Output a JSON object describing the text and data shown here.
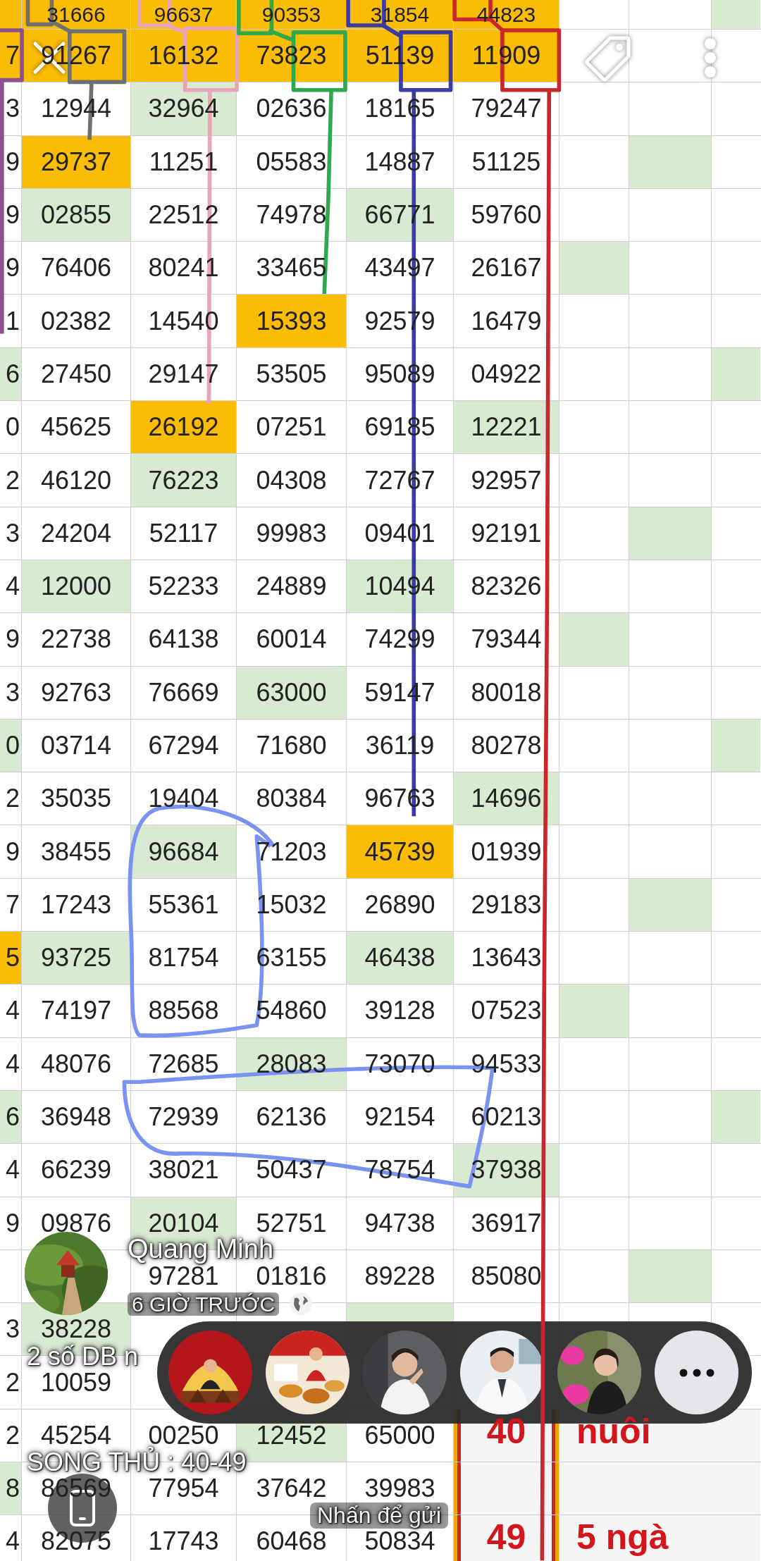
{
  "sheet": {
    "rows": [
      {
        "kind": "plain",
        "cells": [
          {
            "color": "#fbbc04"
          },
          {
            "text": "31666",
            "color": "#fbbc04"
          },
          {
            "text": "96637",
            "color": "#fbbc04"
          },
          {
            "text": "90353",
            "color": "#fbbc04"
          },
          {
            "text": "31854",
            "color": "#fbbc04"
          },
          {
            "text": "44823",
            "color": "#fbbc04"
          },
          {},
          {},
          {
            "color": "#d9ead3"
          }
        ]
      },
      {
        "kind": "plain",
        "cells": [
          {
            "text": "7",
            "color": "#fbbc04"
          },
          {
            "text": "91267",
            "color": "#fbbc04"
          },
          {
            "text": "16132",
            "color": "#fbbc04"
          },
          {
            "text": "73823",
            "color": "#fbbc04"
          },
          {
            "text": "51139",
            "color": "#fbbc04"
          },
          {
            "text": "11909",
            "color": "#fbbc04"
          },
          {},
          {},
          {}
        ]
      },
      {
        "kind": "plain",
        "cells": [
          {
            "text": "3"
          },
          {
            "text": "12944"
          },
          {
            "text": "32964",
            "color": "#d9ead3"
          },
          {
            "text": "02636"
          },
          {
            "text": "18165"
          },
          {
            "text": "79247"
          },
          {},
          {},
          {}
        ]
      },
      {
        "kind": "plain",
        "cells": [
          {
            "text": "9"
          },
          {
            "text": "29737",
            "color": "#fbbc04"
          },
          {
            "text": "11251"
          },
          {
            "text": "05583"
          },
          {
            "text": "14887"
          },
          {
            "text": "51125"
          },
          {},
          {
            "color": "#d9ead3"
          },
          {}
        ]
      },
      {
        "kind": "plain",
        "cells": [
          {
            "text": "9"
          },
          {
            "text": "02855",
            "color": "#d9ead3"
          },
          {
            "text": "22512"
          },
          {
            "text": "74978"
          },
          {
            "text": "66771",
            "color": "#d9ead3"
          },
          {
            "text": "59760"
          },
          {},
          {},
          {}
        ]
      },
      {
        "kind": "plain",
        "cells": [
          {
            "text": "9"
          },
          {
            "text": "76406"
          },
          {
            "text": "80241"
          },
          {
            "text": "33465"
          },
          {
            "text": "43497"
          },
          {
            "text": "26167"
          },
          {
            "color": "#d9ead3"
          },
          {},
          {}
        ]
      },
      {
        "kind": "plain",
        "cells": [
          {
            "text": "1"
          },
          {
            "text": "02382"
          },
          {
            "text": "14540"
          },
          {
            "text": "15393",
            "color": "#fbbc04"
          },
          {
            "text": "92579"
          },
          {
            "text": "16479"
          },
          {},
          {},
          {}
        ]
      },
      {
        "kind": "plain",
        "cells": [
          {
            "text": "6",
            "color": "#d9ead3"
          },
          {
            "text": "27450"
          },
          {
            "text": "29147"
          },
          {
            "text": "53505"
          },
          {
            "text": "95089"
          },
          {
            "text": "04922"
          },
          {},
          {},
          {
            "color": "#d9ead3"
          }
        ]
      },
      {
        "kind": "plain",
        "cells": [
          {
            "text": "0"
          },
          {
            "text": "45625"
          },
          {
            "text": "26192",
            "color": "#fbbc04"
          },
          {
            "text": "07251"
          },
          {
            "text": "69185"
          },
          {
            "text": "12221",
            "color": "#d9ead3"
          },
          {},
          {},
          {}
        ]
      },
      {
        "kind": "plain",
        "cells": [
          {
            "text": "2"
          },
          {
            "text": "46120"
          },
          {
            "text": "76223",
            "color": "#d9ead3"
          },
          {
            "text": "04308"
          },
          {
            "text": "72767"
          },
          {
            "text": "92957"
          },
          {},
          {},
          {}
        ]
      },
      {
        "kind": "plain",
        "cells": [
          {
            "text": "3"
          },
          {
            "text": "24204"
          },
          {
            "text": "52117"
          },
          {
            "text": "99983"
          },
          {
            "text": "09401"
          },
          {
            "text": "92191"
          },
          {},
          {
            "color": "#d9ead3"
          },
          {}
        ]
      },
      {
        "kind": "plain",
        "cells": [
          {
            "text": "4"
          },
          {
            "text": "12000",
            "color": "#d9ead3"
          },
          {
            "text": "52233"
          },
          {
            "text": "24889"
          },
          {
            "text": "10494",
            "color": "#d9ead3"
          },
          {
            "text": "82326"
          },
          {},
          {},
          {}
        ]
      },
      {
        "kind": "plain",
        "cells": [
          {
            "text": "9"
          },
          {
            "text": "22738"
          },
          {
            "text": "64138"
          },
          {
            "text": "60014"
          },
          {
            "text": "74299"
          },
          {
            "text": "79344"
          },
          {
            "color": "#d9ead3"
          },
          {},
          {}
        ]
      },
      {
        "kind": "plain",
        "cells": [
          {
            "text": "3"
          },
          {
            "text": "92763"
          },
          {
            "text": "76669"
          },
          {
            "text": "63000",
            "color": "#d9ead3"
          },
          {
            "text": "59147"
          },
          {
            "text": "80018"
          },
          {},
          {},
          {}
        ]
      },
      {
        "kind": "plain",
        "cells": [
          {
            "text": "0",
            "color": "#d9ead3"
          },
          {
            "text": "03714"
          },
          {
            "text": "67294"
          },
          {
            "text": "71680"
          },
          {
            "text": "36119"
          },
          {
            "text": "80278"
          },
          {},
          {},
          {
            "color": "#d9ead3"
          }
        ]
      },
      {
        "kind": "plain",
        "cells": [
          {
            "text": "2"
          },
          {
            "text": "35035"
          },
          {
            "text": "19404"
          },
          {
            "text": "80384"
          },
          {
            "text": "96763"
          },
          {
            "text": "14696",
            "color": "#d9ead3"
          },
          {},
          {},
          {}
        ]
      },
      {
        "kind": "plain",
        "cells": [
          {
            "text": "9"
          },
          {
            "text": "38455"
          },
          {
            "text": "96684",
            "color": "#d9ead3"
          },
          {
            "text": "71203"
          },
          {
            "text": "45739",
            "color": "#fbbc04"
          },
          {
            "text": "01939"
          },
          {},
          {},
          {}
        ]
      },
      {
        "kind": "plain",
        "cells": [
          {
            "text": "7"
          },
          {
            "text": "17243"
          },
          {
            "text": "55361"
          },
          {
            "text": "15032"
          },
          {
            "text": "26890"
          },
          {
            "text": "29183"
          },
          {},
          {
            "color": "#d9ead3"
          },
          {}
        ]
      },
      {
        "kind": "plain",
        "cells": [
          {
            "text": "5",
            "color": "#fbbc04"
          },
          {
            "text": "93725",
            "color": "#d9ead3"
          },
          {
            "text": "81754"
          },
          {
            "text": "63155"
          },
          {
            "text": "46438",
            "color": "#d9ead3"
          },
          {
            "text": "13643"
          },
          {},
          {},
          {}
        ]
      },
      {
        "kind": "plain",
        "cells": [
          {
            "text": "4"
          },
          {
            "text": "74197"
          },
          {
            "text": "88568"
          },
          {
            "text": "54860"
          },
          {
            "text": "39128"
          },
          {
            "text": "07523"
          },
          {
            "color": "#d9ead3"
          },
          {},
          {}
        ]
      },
      {
        "kind": "plain",
        "cells": [
          {
            "text": "4"
          },
          {
            "text": "48076"
          },
          {
            "text": "72685"
          },
          {
            "text": "28083",
            "color": "#d9ead3"
          },
          {
            "text": "73070"
          },
          {
            "text": "94533"
          },
          {},
          {},
          {}
        ]
      },
      {
        "kind": "plain",
        "cells": [
          {
            "text": "6",
            "color": "#d9ead3"
          },
          {
            "text": "36948"
          },
          {
            "text": "72939"
          },
          {
            "text": "62136"
          },
          {
            "text": "92154"
          },
          {
            "text": "60213"
          },
          {},
          {},
          {
            "color": "#d9ead3"
          }
        ]
      },
      {
        "kind": "plain",
        "cells": [
          {
            "text": "4"
          },
          {
            "text": "66239"
          },
          {
            "text": "38021"
          },
          {
            "text": "50437"
          },
          {
            "text": "78754"
          },
          {
            "text": "37938",
            "color": "#d9ead3"
          },
          {},
          {},
          {}
        ]
      },
      {
        "kind": "plain",
        "cells": [
          {
            "text": "9"
          },
          {
            "text": "09876"
          },
          {
            "text": "20104",
            "color": "#d9ead3"
          },
          {
            "text": "52751"
          },
          {
            "text": "94738"
          },
          {
            "text": "36917"
          },
          {},
          {},
          {}
        ]
      },
      {
        "kind": "plain",
        "cells": [
          {},
          {},
          {
            "text": "97281"
          },
          {
            "text": "01816"
          },
          {
            "text": "89228"
          },
          {
            "text": "85080"
          },
          {},
          {
            "color": "#d9ead3"
          },
          {}
        ]
      },
      {
        "kind": "plain",
        "cells": [
          {
            "text": "3"
          },
          {
            "text": "38228",
            "color": "#d9ead3"
          },
          {},
          {},
          {
            "color": "#d9ead3"
          },
          {},
          {},
          {},
          {}
        ]
      },
      {
        "kind": "plain",
        "cells": [
          {
            "text": "2"
          },
          {
            "text": "10059"
          },
          {},
          {},
          {},
          {},
          {},
          {},
          {}
        ]
      },
      {
        "kind": "note",
        "number": "40",
        "word": "nuôi",
        "cells": [
          {
            "text": "2"
          },
          {
            "text": "45254"
          },
          {
            "text": "00250"
          },
          {
            "text": "12452",
            "color": "#d9ead3"
          },
          {
            "text": "65000"
          }
        ]
      },
      {
        "kind": "note",
        "cells": [
          {
            "text": "8",
            "color": "#d9ead3"
          },
          {
            "text": "86569"
          },
          {
            "text": "77954"
          },
          {
            "text": "37642"
          },
          {
            "text": "39983"
          }
        ]
      },
      {
        "kind": "note",
        "number": "49",
        "word": "5 ngà",
        "cells": [
          {
            "text": "4"
          },
          {
            "text": "82075"
          },
          {
            "text": "17743"
          },
          {
            "text": "60468"
          },
          {
            "text": "50834"
          }
        ]
      }
    ]
  },
  "profile": {
    "name": "Quang Minh",
    "time": "6 GIỜ TRƯỚC"
  },
  "captions": [
    "2 số DB n",
    "SONG THỦ : 40-49"
  ],
  "send_hint": "Nhấn để gửi"
}
